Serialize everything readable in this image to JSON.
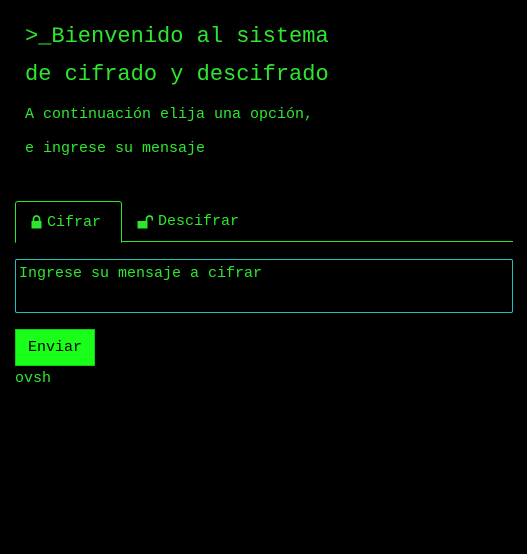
{
  "header": {
    "title_line1": ">_Bienvenido al sistema",
    "title_line2": "de cifrado y descifrado",
    "subtitle_line1": "A continuación elija una opción,",
    "subtitle_line2": "e ingrese su mensaje"
  },
  "tabs": [
    {
      "label": "Cifrar",
      "icon": "lock-icon",
      "active": true
    },
    {
      "label": "Descifrar",
      "icon": "unlock-icon",
      "active": false
    }
  ],
  "form": {
    "message_placeholder": "Ingrese su mensaje a cifrar",
    "message_value": "",
    "submit_label": "Enviar"
  },
  "result": {
    "text": "ovsh"
  },
  "colors": {
    "background": "#000000",
    "text": "#2ee62e",
    "input_border": "#20c0c0",
    "button_bg": "#1aff1a"
  }
}
